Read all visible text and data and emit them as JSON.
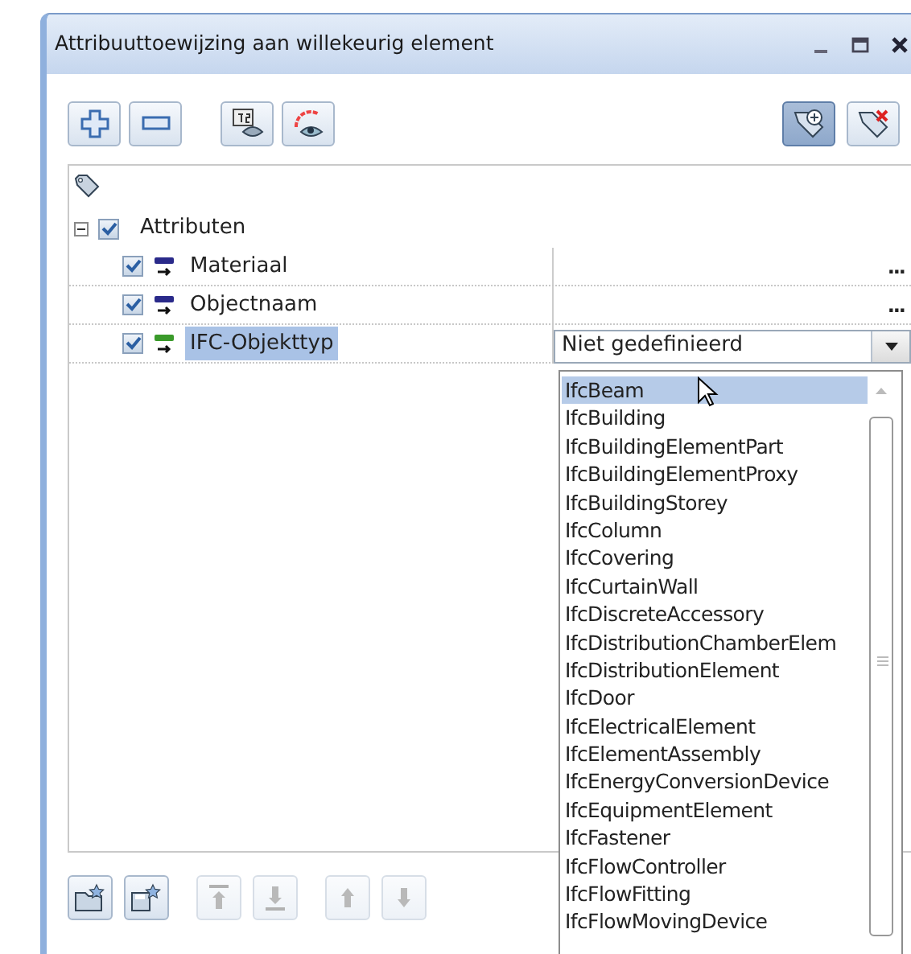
{
  "window": {
    "title": "Attribuuttoewijzing aan willekeurig element"
  },
  "toolbar": {
    "left": [
      {
        "kind": "add",
        "pressed": false
      },
      {
        "kind": "remove",
        "pressed": false
      },
      {
        "kind": "number-eye",
        "pressed": false
      },
      {
        "kind": "color-eye",
        "pressed": false
      }
    ],
    "right": [
      {
        "kind": "tag-add",
        "pressed": true
      },
      {
        "kind": "tag-delete",
        "pressed": false
      }
    ]
  },
  "tree": {
    "label": "Attributen",
    "expanded": true,
    "checked": true,
    "children": [
      {
        "label": "Materiaal",
        "kind": "text",
        "checked": true,
        "selected": false,
        "value_button": "..."
      },
      {
        "label": "Objectnaam",
        "kind": "text",
        "checked": true,
        "selected": false,
        "value_button": "..."
      },
      {
        "label": "IFC-Objekttyp",
        "kind": "number",
        "checked": true,
        "selected": true,
        "combo": {
          "value": "Niet gedefinieerd",
          "open": true
        }
      }
    ]
  },
  "dropdown": {
    "items": [
      {
        "label": "IfcBeam",
        "selected": true
      },
      {
        "label": "IfcBuilding",
        "selected": false
      },
      {
        "label": "IfcBuildingElementPart",
        "selected": false
      },
      {
        "label": "IfcBuildingElementProxy",
        "selected": false
      },
      {
        "label": "IfcBuildingStorey",
        "selected": false
      },
      {
        "label": "IfcColumn",
        "selected": false
      },
      {
        "label": "IfcCovering",
        "selected": false
      },
      {
        "label": "IfcCurtainWall",
        "selected": false
      },
      {
        "label": "IfcDiscreteAccessory",
        "selected": false
      },
      {
        "label": "IfcDistributionChamberElem",
        "selected": false
      },
      {
        "label": "IfcDistributionElement",
        "selected": false
      },
      {
        "label": "IfcDoor",
        "selected": false
      },
      {
        "label": "IfcElectricalElement",
        "selected": false
      },
      {
        "label": "IfcElementAssembly",
        "selected": false
      },
      {
        "label": "IfcEnergyConversionDevice",
        "selected": false
      },
      {
        "label": "IfcEquipmentElement",
        "selected": false
      },
      {
        "label": "IfcFastener",
        "selected": false
      },
      {
        "label": "IfcFlowController",
        "selected": false
      },
      {
        "label": "IfcFlowFitting",
        "selected": false
      },
      {
        "label": "IfcFlowMovingDevice",
        "selected": false
      }
    ]
  },
  "bottom_toolbar": [
    {
      "kind": "open-favorite",
      "disabled": false
    },
    {
      "kind": "save-favorite",
      "disabled": false
    },
    {
      "kind": "move-top",
      "disabled": true
    },
    {
      "kind": "move-bottom",
      "disabled": true
    },
    {
      "kind": "move-up",
      "disabled": true
    },
    {
      "kind": "move-down",
      "disabled": true
    }
  ]
}
